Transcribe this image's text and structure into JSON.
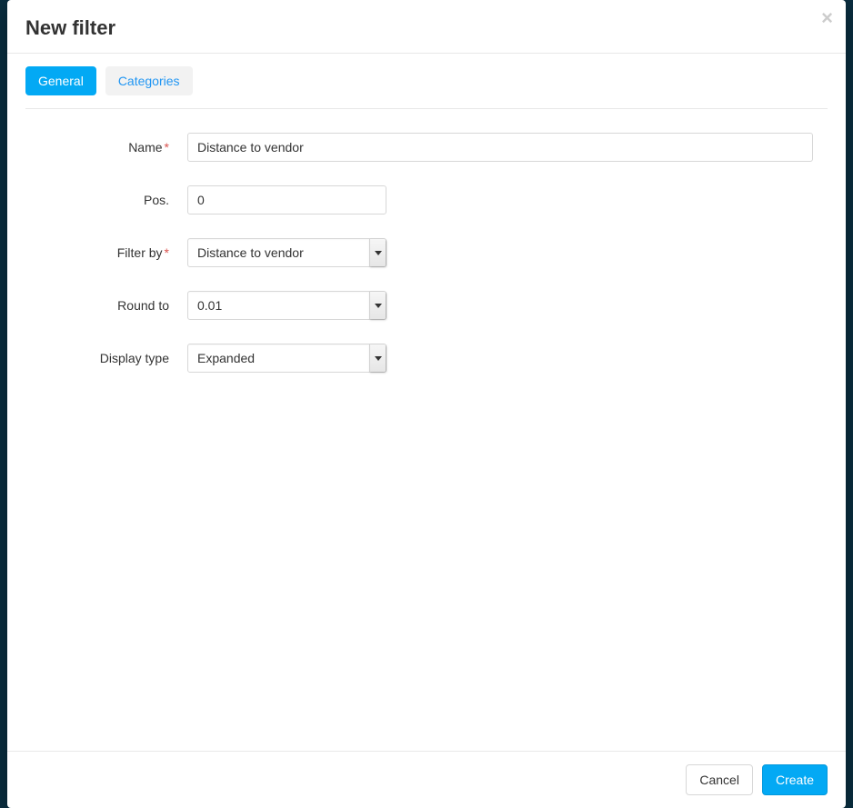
{
  "modal": {
    "title": "New filter",
    "tabs": [
      {
        "label": "General",
        "active": true
      },
      {
        "label": "Categories",
        "active": false
      }
    ],
    "fields": {
      "name": {
        "label": "Name",
        "required": true,
        "value": "Distance to vendor"
      },
      "pos": {
        "label": "Pos.",
        "required": false,
        "value": "0"
      },
      "filter_by": {
        "label": "Filter by",
        "required": true,
        "value": "Distance to vendor"
      },
      "round_to": {
        "label": "Round to",
        "required": false,
        "value": "0.01"
      },
      "display_type": {
        "label": "Display type",
        "required": false,
        "value": "Expanded"
      }
    },
    "buttons": {
      "cancel": "Cancel",
      "create": "Create"
    }
  }
}
